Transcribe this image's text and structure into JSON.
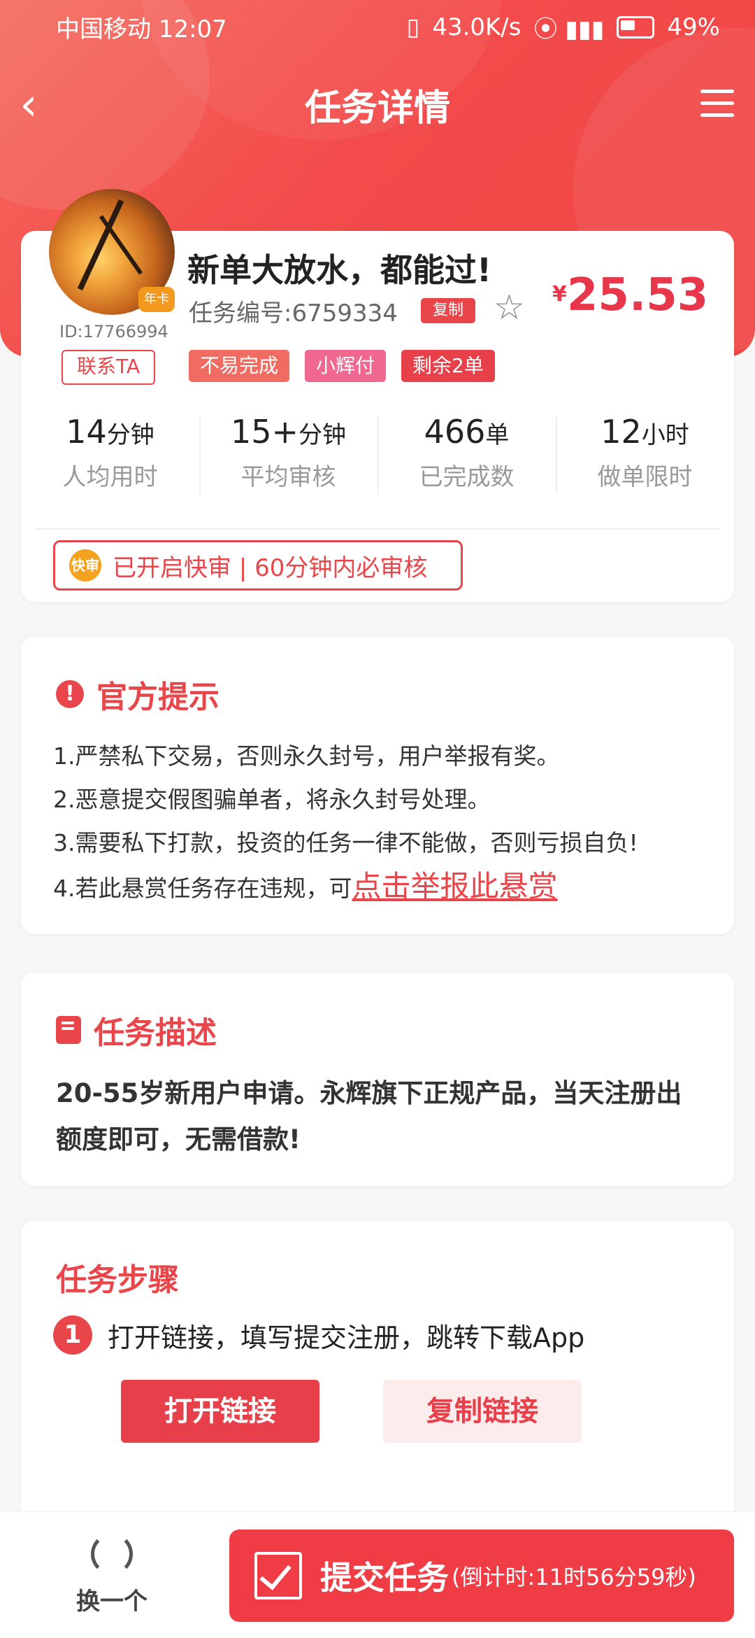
{
  "status_bar": {
    "carrier_time": "中国移动 12:07",
    "speed": "43.0K/s",
    "battery": "49%"
  },
  "nav": {
    "back_glyph": "‹",
    "title": "任务详情"
  },
  "task": {
    "user_id": "ID:17766994",
    "avatar_badge": "年卡",
    "contact_label": "联系TA",
    "title": "新单大放水，都能过!",
    "task_no": "任务编号:6759334",
    "copy_label": "复制",
    "star_glyph": "☆",
    "price_symbol": "¥",
    "price": "25.53",
    "tags": [
      "不易完成",
      "小辉付",
      "剩余2单"
    ],
    "stats": [
      {
        "value": "14",
        "unit": "分钟",
        "label": "人均用时"
      },
      {
        "value": "15+",
        "unit": "分钟",
        "label": "平均审核"
      },
      {
        "value": "466",
        "unit": "单",
        "label": "已完成数"
      },
      {
        "value": "12",
        "unit": "小时",
        "label": "做单限时"
      }
    ],
    "fast_badge": "快审",
    "fast_text": "已开启快审 | 60分钟内必审核"
  },
  "tips": {
    "icon_glyph": "!",
    "title": "官方提示",
    "items": [
      "1.严禁私下交易，否则永久封号，用户举报有奖。",
      "2.恶意提交假图骗单者，将永久封号处理。",
      "3.需要私下打款，投资的任务一律不能做，否则亏损自负!",
      "4.若此悬赏任务存在违规，可"
    ],
    "report_link": "点击举报此悬赏"
  },
  "description": {
    "title": "任务描述",
    "text": "20-55岁新用户申请。永辉旗下正规产品，当天注册出额度即可，无需借款!"
  },
  "steps": {
    "title": "任务步骤",
    "step_num": "1",
    "step_text": "打开链接，填写提交注册，跳转下载App",
    "open_label": "打开链接",
    "copy_label": "复制链接"
  },
  "bottom": {
    "switch_label": "换一个",
    "submit_label": "提交任务",
    "countdown": "(倒计时:11时56分59秒)"
  },
  "colors": {
    "accent": "#e8464a",
    "header": "#f34b4b"
  }
}
